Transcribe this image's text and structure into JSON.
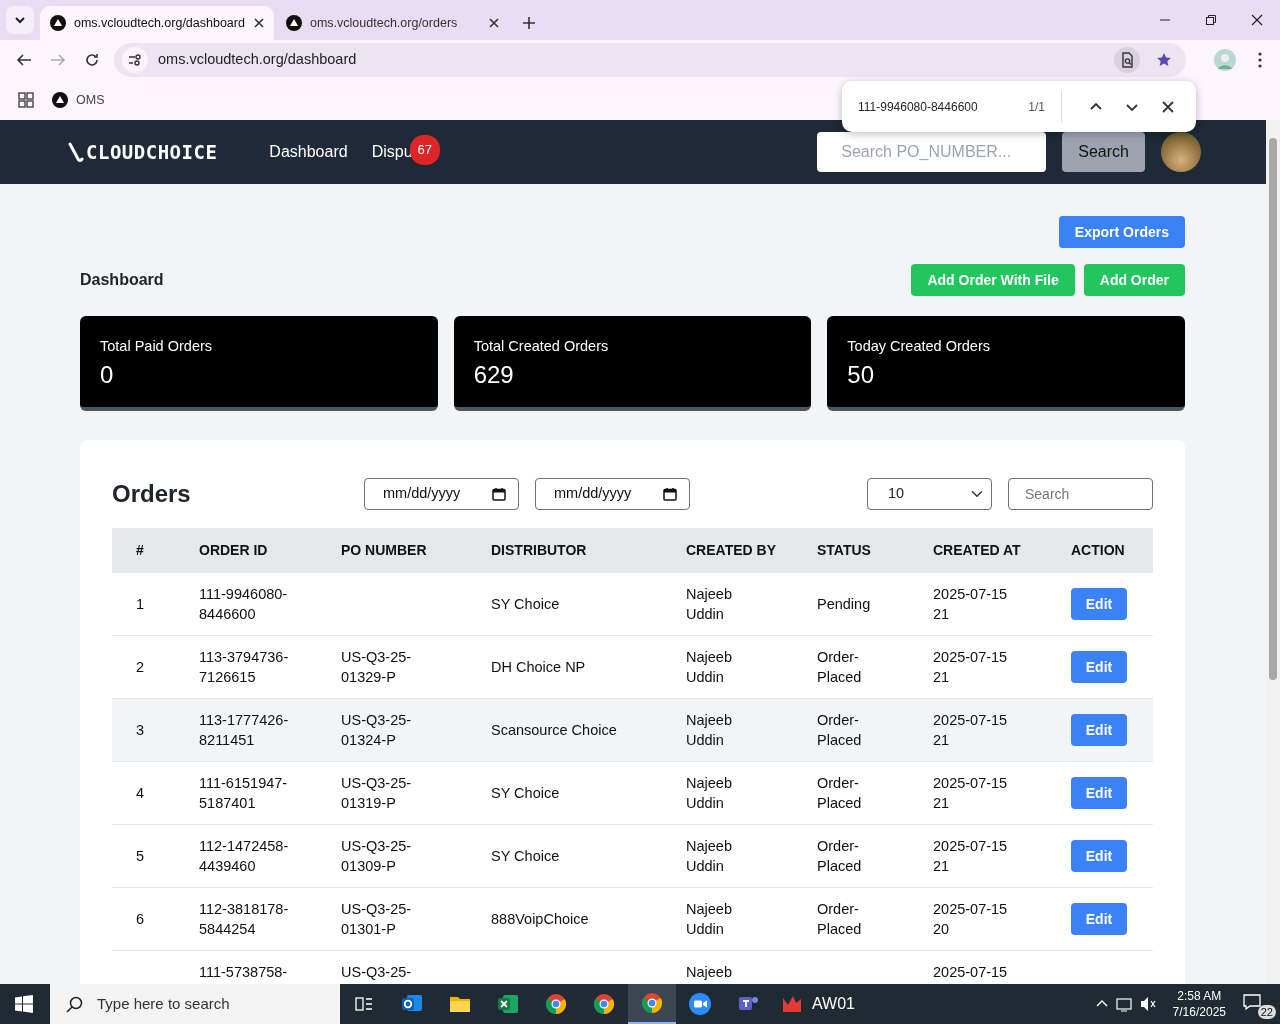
{
  "browser": {
    "tabs": [
      {
        "title": "oms.vcloudtech.org/dashboard",
        "selected": true
      },
      {
        "title": "oms.vcloudtech.org/orders",
        "selected": false
      }
    ],
    "url": "oms.vcloudtech.org/dashboard",
    "bookmarks": [
      {
        "label": "OMS"
      }
    ],
    "find_bar": {
      "query": "111-9946080-8446600",
      "count": "1/1"
    }
  },
  "navbar": {
    "logo": "CLOUDCHOICE",
    "links": [
      {
        "label": "Dashboard"
      },
      {
        "label": "Dispu",
        "badge": "67"
      }
    ],
    "search": {
      "placeholder": "Search PO_NUMBER..."
    },
    "search_button": "Search"
  },
  "page": {
    "export_button": "Export Orders",
    "title": "Dashboard",
    "buttons": [
      "Add Order With File",
      "Add Order"
    ]
  },
  "stats": [
    {
      "label": "Total Paid Orders",
      "value": "0"
    },
    {
      "label": "Total Created Orders",
      "value": "629"
    },
    {
      "label": "Today Created Orders",
      "value": "50"
    }
  ],
  "orders": {
    "title": "Orders",
    "date_from": {
      "placeholder": "mm/dd/yyyy"
    },
    "date_to": {
      "placeholder": "mm/dd/yyyy"
    },
    "page_size": "10",
    "search": {
      "placeholder": "Search"
    },
    "columns": [
      "#",
      "ORDER ID",
      "PO NUMBER",
      "DISTRIBUTOR",
      "CREATED BY",
      "STATUS",
      "CREATED AT",
      "ACTION"
    ],
    "rows": [
      {
        "index": "1",
        "order_id": "111-9946080-8446600",
        "distributor": "SY Choice",
        "created_by": "Najeeb Uddin",
        "status": "Pending",
        "created_at": "2025-07-15 21",
        "action": "Edit",
        "highlighted": false
      },
      {
        "index": "2",
        "order_id": "113-3794736-7126615",
        "po_number": "US-Q3-25-01329-P",
        "distributor": "DH Choice NP",
        "created_by": "Najeeb Uddin",
        "status": "Order-Placed",
        "created_at": "2025-07-15 21",
        "action": "Edit",
        "highlighted": false
      },
      {
        "index": "3",
        "order_id": "113-1777426-8211451",
        "po_number": "US-Q3-25-01324-P",
        "distributor": "Scansource Choice",
        "created_by": "Najeeb Uddin",
        "status": "Order-Placed",
        "created_at": "2025-07-15 21",
        "action": "Edit",
        "highlighted": true
      },
      {
        "index": "4",
        "order_id": "111-6151947-5187401",
        "po_number": "US-Q3-25-01319-P",
        "distributor": "SY Choice",
        "created_by": "Najeeb Uddin",
        "status": "Order-Placed",
        "created_at": "2025-07-15 21",
        "action": "Edit",
        "highlighted": false
      },
      {
        "index": "5",
        "order_id": "112-1472458-4439460",
        "po_number": "US-Q3-25-01309-P",
        "distributor": "SY Choice",
        "created_by": "Najeeb Uddin",
        "status": "Order-Placed",
        "created_at": "2025-07-15 21",
        "action": "Edit",
        "highlighted": false
      },
      {
        "index": "6",
        "order_id": "112-3818178-5844254",
        "po_number": "US-Q3-25-01301-P",
        "distributor": "888VoipChoice",
        "created_by": "Najeeb Uddin",
        "status": "Order-Placed",
        "created_at": "2025-07-15 20",
        "action": "Edit",
        "highlighted": false
      },
      {
        "order_id": "111-5738758-",
        "po_number": "US-Q3-25-",
        "created_by": "Najeeb",
        "created_at": "2025-07-15",
        "highlighted": false
      }
    ]
  },
  "taskbar": {
    "search_placeholder": "Type here to search",
    "apps": [
      {
        "kind": "outlook",
        "active": false
      },
      {
        "kind": "explorer",
        "active": false
      },
      {
        "kind": "excel",
        "active": false
      },
      {
        "kind": "chrome",
        "active": false
      },
      {
        "kind": "chrome",
        "active": false
      },
      {
        "kind": "chrome",
        "active": true
      },
      {
        "kind": "zoom",
        "active": false
      },
      {
        "kind": "teams",
        "active": false
      },
      {
        "kind": "app",
        "label": "AW01",
        "active": false
      }
    ],
    "time": "2:58 AM",
    "date": "7/16/2025",
    "notifications": "22"
  }
}
